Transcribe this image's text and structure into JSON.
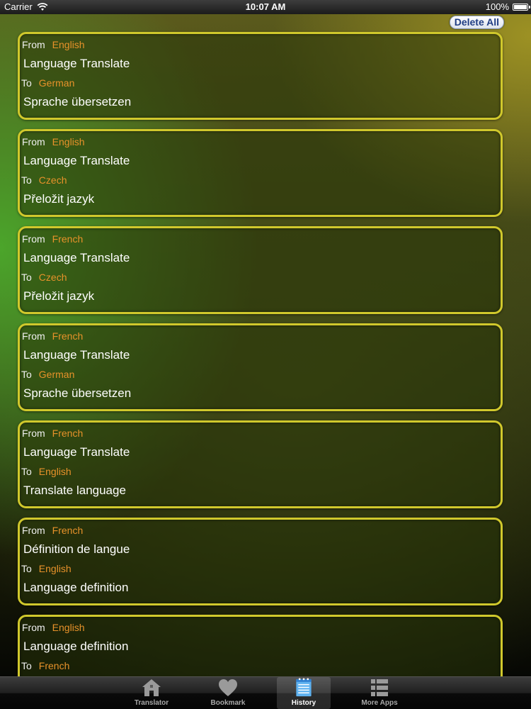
{
  "status_bar": {
    "carrier": "Carrier",
    "time": "10:07 AM",
    "battery": "100%"
  },
  "toolbar": {
    "delete_all_label": "Delete All"
  },
  "history": [
    {
      "from_label": "From",
      "from_lang": "English",
      "source": "Language Translate",
      "to_label": "To",
      "to_lang": "German",
      "target": "Sprache übersetzen"
    },
    {
      "from_label": "From",
      "from_lang": "English",
      "source": "Language Translate",
      "to_label": "To",
      "to_lang": "Czech",
      "target": "Přeložit jazyk"
    },
    {
      "from_label": "From",
      "from_lang": "French",
      "source": "Language Translate",
      "to_label": "To",
      "to_lang": "Czech",
      "target": "Přeložit jazyk"
    },
    {
      "from_label": "From",
      "from_lang": "French",
      "source": "Language Translate",
      "to_label": "To",
      "to_lang": "German",
      "target": "Sprache übersetzen"
    },
    {
      "from_label": "From",
      "from_lang": "French",
      "source": "Language Translate",
      "to_label": "To",
      "to_lang": "English",
      "target": "Translate language"
    },
    {
      "from_label": "From",
      "from_lang": "French",
      "source": "Définition de langue",
      "to_label": "To",
      "to_lang": "English",
      "target": "Language definition"
    },
    {
      "from_label": "From",
      "from_lang": "English",
      "source": "Language definition",
      "to_label": "To",
      "to_lang": "French",
      "target": ""
    }
  ],
  "tabs": [
    {
      "label": "Translator",
      "icon": "house-icon"
    },
    {
      "label": "Bookmark",
      "icon": "heart-icon"
    },
    {
      "label": "History",
      "icon": "notepad-icon"
    },
    {
      "label": "More Apps",
      "icon": "list-icon"
    }
  ],
  "colors": {
    "card_border": "#d0c82c",
    "language_text": "#e8922a",
    "delete_button_text": "#1f3d84"
  }
}
